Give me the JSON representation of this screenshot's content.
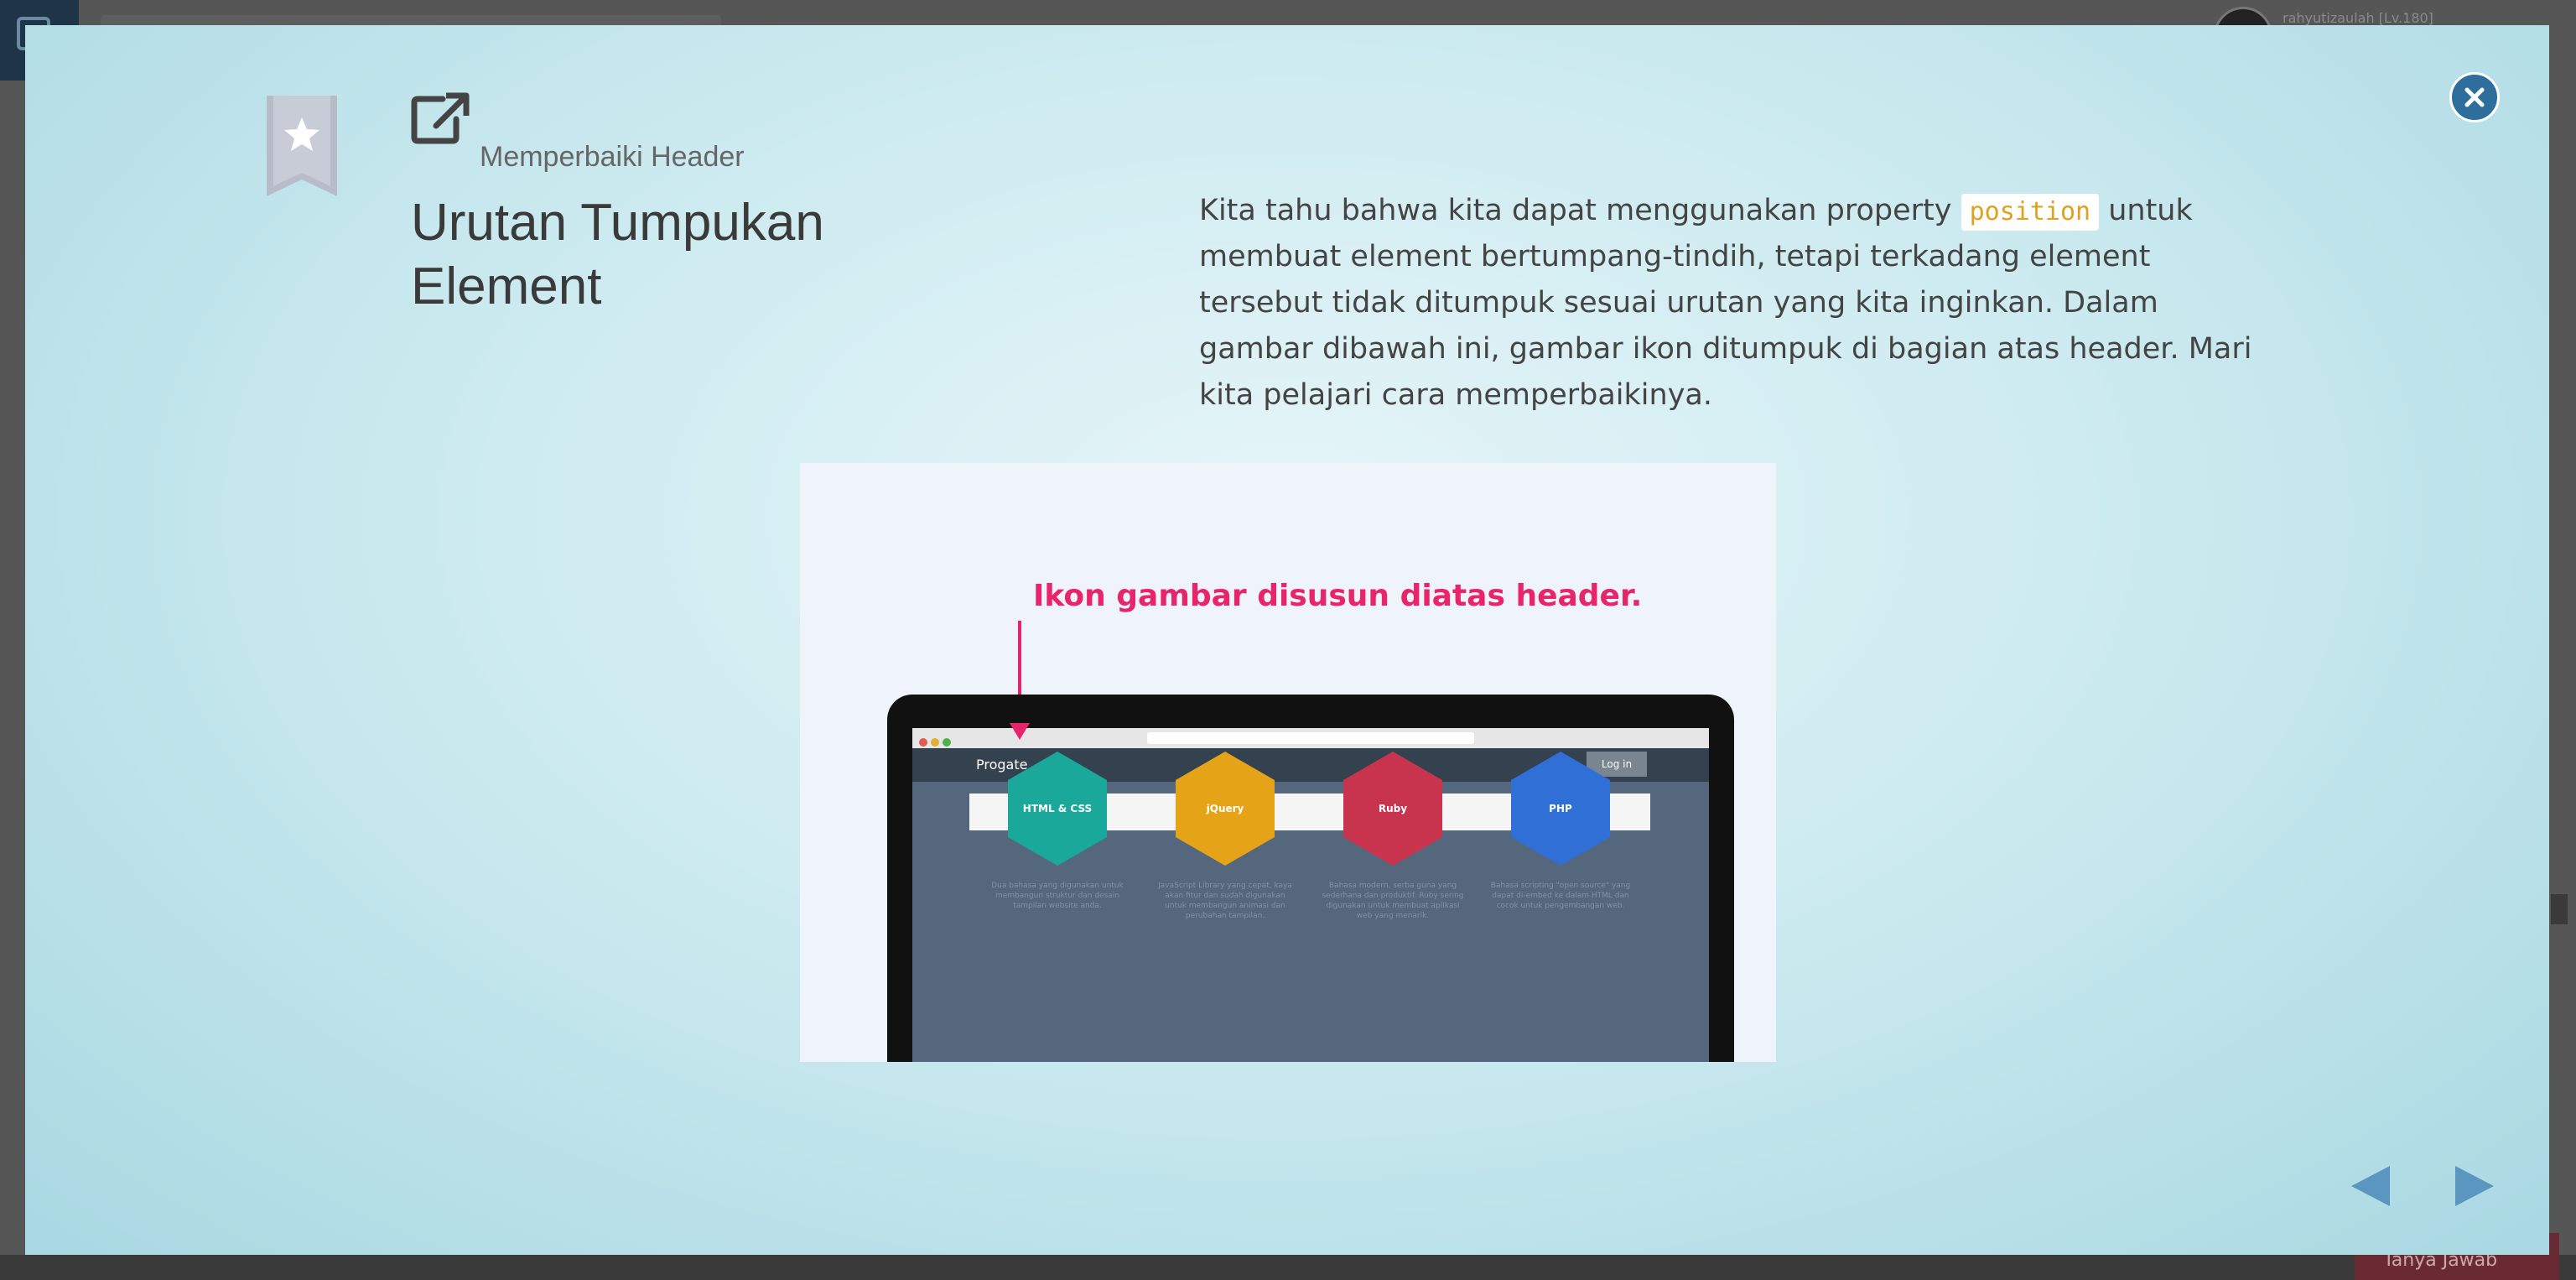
{
  "background": {
    "user_name": "rahyutizaulah [Lv.180]",
    "bottom_button": "Tanya Jawab"
  },
  "modal": {
    "lesson_label": "Memperbaiki Header",
    "title": "Urutan Tumpukan Element",
    "description": {
      "before_code": "Kita tahu bahwa kita dapat menggunakan property ",
      "code": "position",
      "after_code": " untuk membuat element bertumpang-tindih, tetapi terkadang element tersebut tidak ditumpuk sesuai urutan yang kita inginkan. Dalam gambar dibawah ini, gambar ikon ditumpuk di bagian atas header. Mari kita pelajari cara memperbaikinya."
    },
    "illustration": {
      "caption": "Ikon gambar disusun diatas header.",
      "site_logo": "Progate",
      "login_label": "Log in",
      "courses": [
        {
          "name": "HTML & CSS",
          "color": "#1aa89a",
          "desc": "Dua bahasa yang digunakan untuk membangun struktur dan desain tampilan website anda."
        },
        {
          "name": "jQuery",
          "color": "#e5a318",
          "desc": "JavaScript Library yang cepat, kaya akan fitur dan sudah digunakan untuk membangun animasi dan perubahan tampilan."
        },
        {
          "name": "Ruby",
          "color": "#c8344e",
          "desc": "Bahasa modern, serba guna yang sederhana dan produktif. Ruby sering digunakan untuk membuat aplikasi web yang menarik."
        },
        {
          "name": "PHP",
          "color": "#2f6fd6",
          "desc": "Bahasa scripting \"open source\" yang dapat di-embed ke dalam HTML dan cocok untuk pengembangan web."
        }
      ]
    },
    "icons": {
      "close": "close-icon",
      "bookmark": "star-bookmark-icon",
      "external": "external-link-icon",
      "prev": "arrow-left-icon",
      "next": "arrow-right-icon"
    },
    "colors": {
      "accent": "#2d6e9c",
      "caption": "#e8246a",
      "code": "#e0a020",
      "nav": "#5b96c0"
    }
  }
}
